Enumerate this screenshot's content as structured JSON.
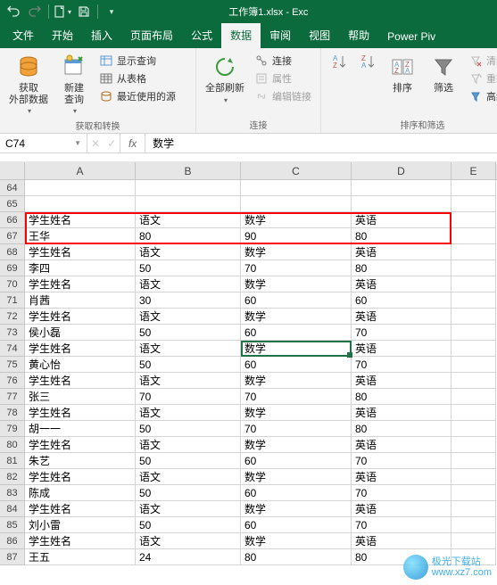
{
  "titlebar": {
    "title": "工作簿1.xlsx - Exc"
  },
  "tabs": [
    "文件",
    "开始",
    "插入",
    "页面布局",
    "公式",
    "数据",
    "审阅",
    "视图",
    "帮助",
    "Power Piv"
  ],
  "active_tab_index": 5,
  "ribbon": {
    "group1": {
      "get_external": "获取\n外部数据",
      "new_query": "新建\n查询",
      "show_query": "显示查询",
      "from_table": "从表格",
      "recent_sources": "最近使用的源",
      "label": "获取和转换"
    },
    "group2": {
      "refresh_all": "全部刷新",
      "connect": "连接",
      "properties": "属性",
      "edit_links": "编辑链接",
      "label": "连接"
    },
    "group3": {
      "sort": "排序",
      "filter": "筛选",
      "clear": "清除",
      "reapply": "重新应",
      "advanced": "高级",
      "label": "排序和筛选"
    }
  },
  "namebox": "C74",
  "formula": "数学",
  "columns": [
    "A",
    "B",
    "C",
    "D",
    "E"
  ],
  "row_start": 64,
  "row_end": 87,
  "cells": {
    "66": [
      "学生姓名",
      "语文",
      "数学",
      "英语"
    ],
    "67": [
      "王华",
      "80",
      "90",
      "80"
    ],
    "68": [
      "学生姓名",
      "语文",
      "数学",
      "英语"
    ],
    "69": [
      "李四",
      "50",
      "70",
      "80"
    ],
    "70": [
      "学生姓名",
      "语文",
      "数学",
      "英语"
    ],
    "71": [
      "肖茜",
      "30",
      "60",
      "60"
    ],
    "72": [
      "学生姓名",
      "语文",
      "数学",
      "英语"
    ],
    "73": [
      "侯小磊",
      "50",
      "60",
      "70"
    ],
    "74": [
      "学生姓名",
      "语文",
      "数学",
      "英语"
    ],
    "75": [
      "黄心怡",
      "50",
      "60",
      "70"
    ],
    "76": [
      "学生姓名",
      "语文",
      "数学",
      "英语"
    ],
    "77": [
      "张三",
      "70",
      "70",
      "80"
    ],
    "78": [
      "学生姓名",
      "语文",
      "数学",
      "英语"
    ],
    "79": [
      "胡一一",
      "50",
      "70",
      "80"
    ],
    "80": [
      "学生姓名",
      "语文",
      "数学",
      "英语"
    ],
    "81": [
      "朱艺",
      "50",
      "60",
      "70"
    ],
    "82": [
      "学生姓名",
      "语文",
      "数学",
      "英语"
    ],
    "83": [
      "陈成",
      "50",
      "60",
      "70"
    ],
    "84": [
      "学生姓名",
      "语文",
      "数学",
      "英语"
    ],
    "85": [
      "刘小雷",
      "50",
      "60",
      "70"
    ],
    "86": [
      "学生姓名",
      "语文",
      "数学",
      "英语"
    ],
    "87": [
      "王五",
      "24",
      "80",
      "80"
    ]
  },
  "watermark": {
    "line1": "极光下载站",
    "line2": "www.xz7.com"
  }
}
